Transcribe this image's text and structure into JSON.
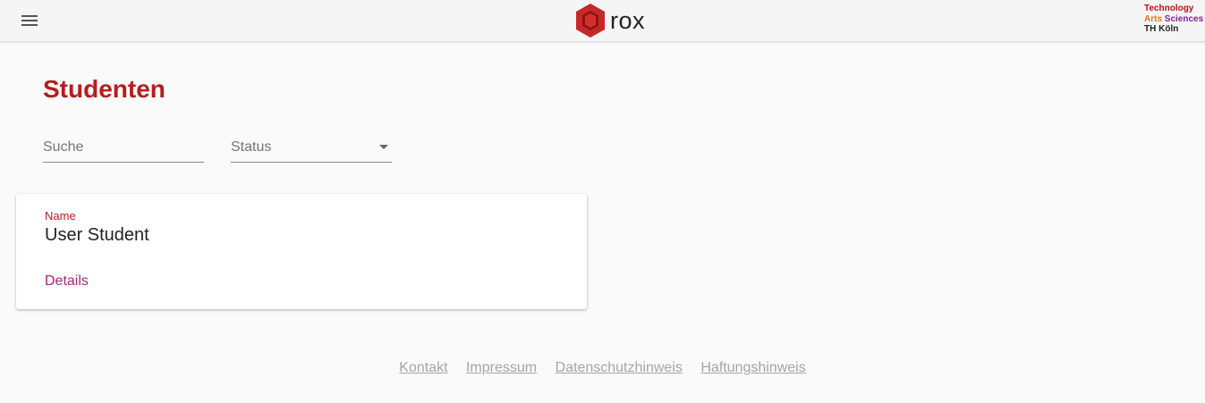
{
  "header": {
    "menu_icon": "hamburger-menu-icon",
    "logo_text": "rox",
    "logo_icon": "rox-hexagon-logo",
    "brand_color": "#c62828",
    "partner_logo": {
      "line1": "Technology",
      "line2a": "Arts",
      "line2b": "Sciences",
      "line3": "TH Köln"
    }
  },
  "main": {
    "title": "Studenten",
    "title_color": "#b71c1c",
    "search": {
      "placeholder": "Suche",
      "value": ""
    },
    "status_select": {
      "label": "Status",
      "icon": "dropdown-caret-icon"
    }
  },
  "students": [
    {
      "name_label": "Name",
      "name": "User Student",
      "details_label": "Details"
    }
  ],
  "footer": {
    "links": [
      "Kontakt",
      "Impressum",
      "Datenschutzhinweis",
      "Haftungshinweis"
    ]
  }
}
